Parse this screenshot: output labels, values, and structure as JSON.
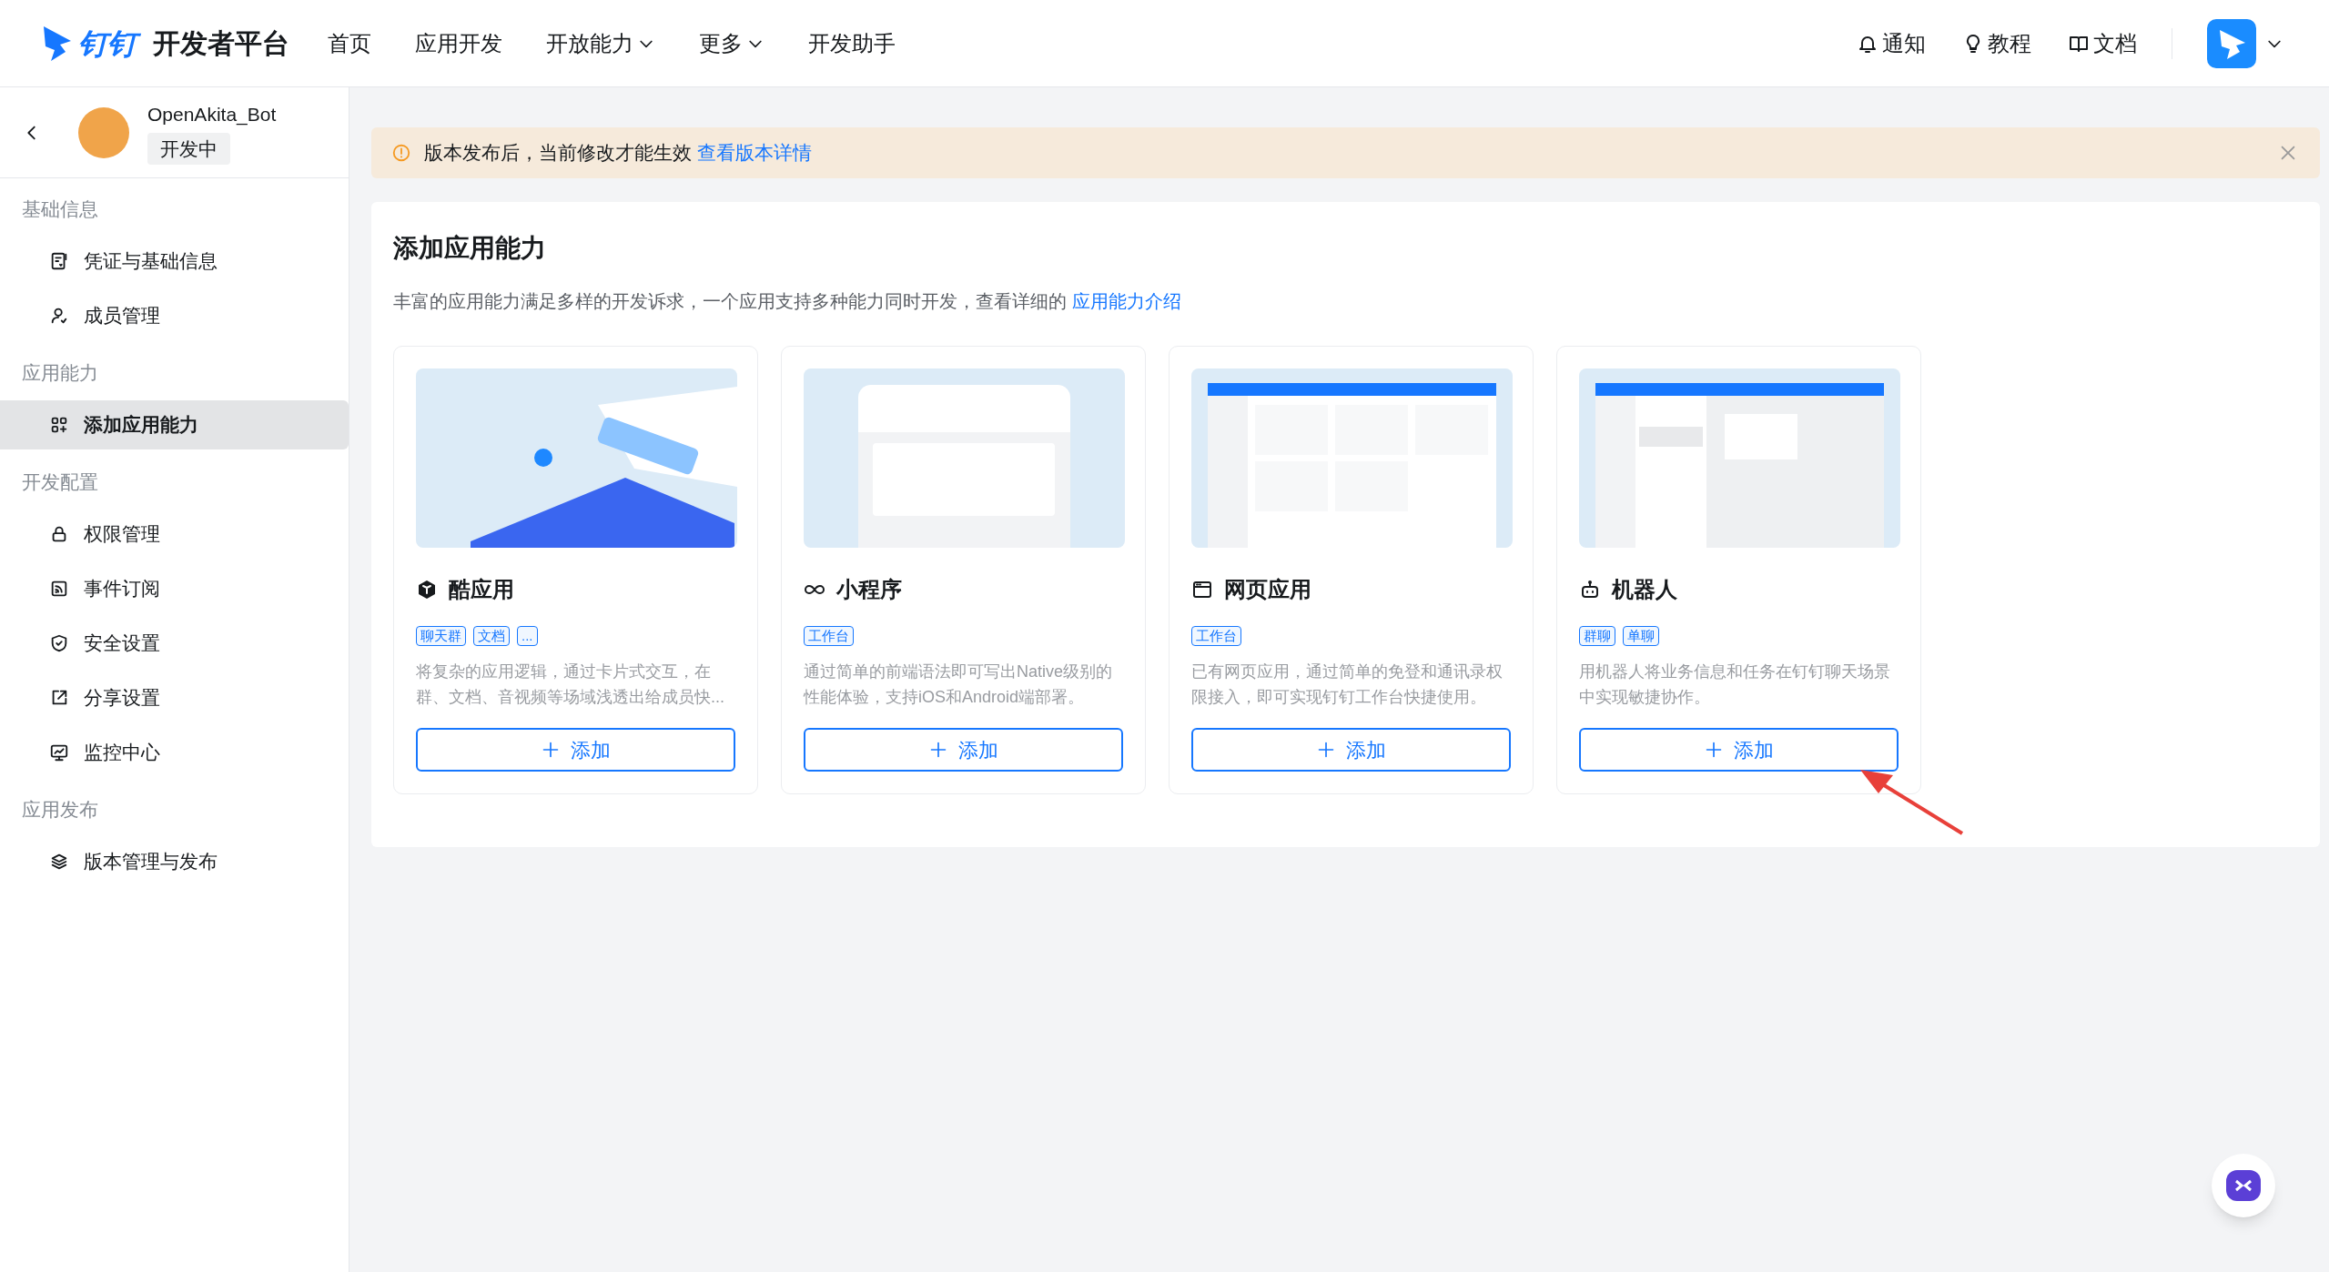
{
  "header": {
    "logo_text": "钉钉",
    "brand": "开发者平台",
    "nav": [
      {
        "label": "首页",
        "dropdown": false
      },
      {
        "label": "应用开发",
        "dropdown": false
      },
      {
        "label": "开放能力",
        "dropdown": true
      },
      {
        "label": "更多",
        "dropdown": true
      },
      {
        "label": "开发助手",
        "dropdown": false
      }
    ],
    "actions": [
      {
        "label": "通知"
      },
      {
        "label": "教程"
      },
      {
        "label": "文档"
      }
    ]
  },
  "sidebar": {
    "app": {
      "name": "OpenAkita_Bot",
      "status": "开发中"
    },
    "sections": [
      {
        "title": "基础信息",
        "items": [
          {
            "label": "凭证与基础信息",
            "selected": false
          },
          {
            "label": "成员管理",
            "selected": false
          }
        ]
      },
      {
        "title": "应用能力",
        "items": [
          {
            "label": "添加应用能力",
            "selected": true
          }
        ]
      },
      {
        "title": "开发配置",
        "items": [
          {
            "label": "权限管理",
            "selected": false
          },
          {
            "label": "事件订阅",
            "selected": false
          },
          {
            "label": "安全设置",
            "selected": false
          },
          {
            "label": "分享设置",
            "selected": false
          },
          {
            "label": "监控中心",
            "selected": false
          }
        ]
      },
      {
        "title": "应用发布",
        "items": [
          {
            "label": "版本管理与发布",
            "selected": false
          }
        ]
      }
    ]
  },
  "banner": {
    "text": "版本发布后，当前修改才能生效",
    "link": "查看版本详情"
  },
  "main": {
    "title": "添加应用能力",
    "description": "丰富的应用能力满足多样的开发诉求，一个应用支持多种能力同时开发，查看详细的",
    "link": "应用能力介绍",
    "cards": [
      {
        "title": "酷应用",
        "tags": [
          "聊天群",
          "文档",
          "..."
        ],
        "description": "将复杂的应用逻辑，通过卡片式交互，在群、文档、音视频等场域浅透出给成员快...",
        "button": "添加"
      },
      {
        "title": "小程序",
        "tags": [
          "工作台"
        ],
        "description": "通过简单的前端语法即可写出Native级别的性能体验，支持iOS和Android端部署。",
        "button": "添加"
      },
      {
        "title": "网页应用",
        "tags": [
          "工作台"
        ],
        "description": "已有网页应用，通过简单的免登和通讯录权限接入，即可实现钉钉工作台快捷使用。",
        "button": "添加"
      },
      {
        "title": "机器人",
        "tags": [
          "群聊",
          "单聊"
        ],
        "description": "用机器人将业务信息和任务在钉钉聊天场景中实现敏捷协作。",
        "button": "添加"
      }
    ]
  }
}
